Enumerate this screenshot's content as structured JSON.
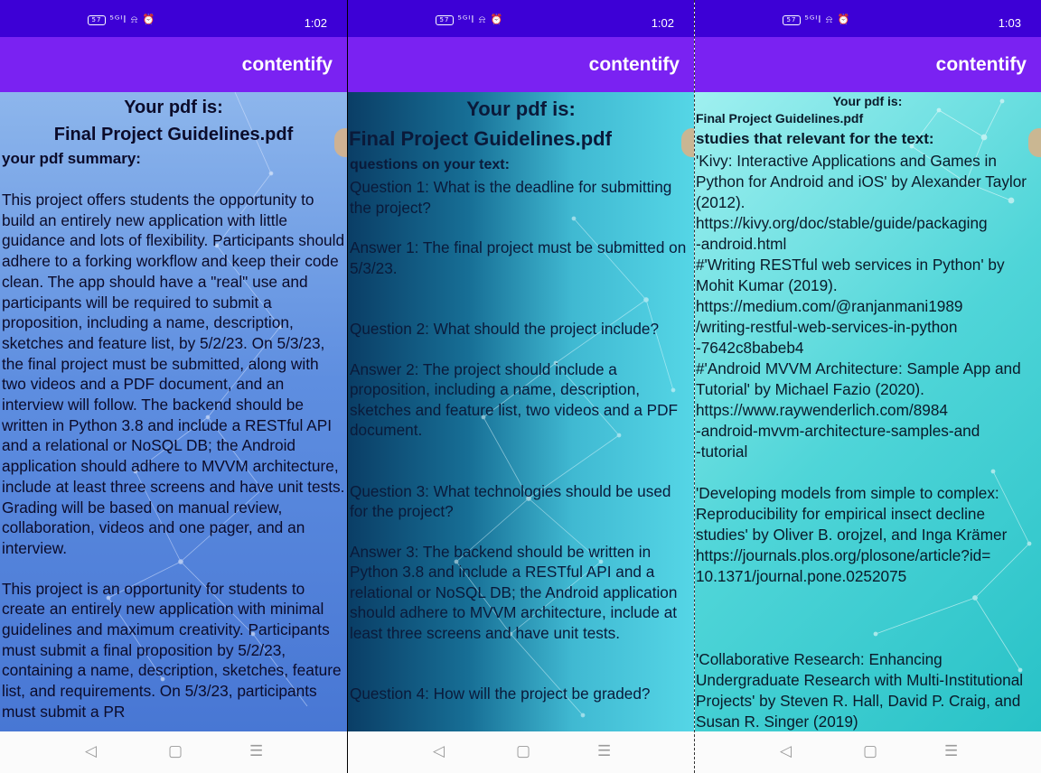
{
  "colors": {
    "status_bar": "#3d00d6",
    "app_bar": "#7a22f2",
    "nav_bar": "#fbfbfb"
  },
  "screens": [
    {
      "status": {
        "icons": "⁵ᴳᴵl ⍾ ⏰",
        "battery": "57",
        "time": "1:02"
      },
      "app_title": "contentify",
      "heading": "Your pdf is:",
      "filename": "Final Project Guidelines.pdf",
      "section": "your pdf summary:",
      "paragraphs": [
        "This project offers students the opportunity to build an entirely new application with little guidance and lots of flexibility. Participants should adhere to a forking workflow and keep their code clean. The app should have a \"real\" use and participants will be required to submit a proposition, including a name, description, sketches and feature list, by 5/2/23. On 5/3/23, the final project must be submitted, along with two videos and a PDF document, and an interview will follow. The backend should be written in Python 3.8 and include a RESTful API and a relational or NoSQL DB; the Android application should adhere to MVVM architecture, include at least three screens and have unit tests. Grading will be based on manual review, collaboration, videos and one pager, and an interview.",
        "This project is an opportunity for students to create an entirely new application with minimal guidelines and maximum creativity. Participants must submit a final proposition by 5/2/23, containing a name, description, sketches, feature list, and requirements. On 5/3/23, participants must submit a PR"
      ],
      "nav": {
        "back": "◁",
        "home": "▢",
        "menu": "☰"
      }
    },
    {
      "status": {
        "icons": "⁵ᴳᴵl ⍾ ⏰",
        "battery": "57",
        "time": "1:02"
      },
      "app_title": "contentify",
      "heading": "Your pdf is:",
      "filename": "Final Project Guidelines.pdf",
      "section": "questions on your text:",
      "qa": [
        "Question 1: What is the deadline for submitting the project?",
        "Answer 1: The final project must be submitted on 5/3/23.",
        "Question 2: What should the project include?",
        "Answer 2: The project should include a proposition, including a name, description, sketches and feature list, two videos and a PDF document.",
        "Question 3: What technologies should be used for the project?",
        "Answer 3: The backend should be written in Python 3.8 and include a RESTful API and a relational or NoSQL DB; the Android application should adhere to MVVM architecture, include at least three screens and have unit tests.",
        "Question 4: How will the project be graded?"
      ],
      "nav": {
        "back": "◁",
        "home": "▢",
        "menu": "☰"
      }
    },
    {
      "status": {
        "icons": "⁵ᴳᴵl ⍾ ⏰",
        "battery": "57",
        "time": "1:03"
      },
      "app_title": "contentify",
      "heading": "Your pdf is:",
      "filename": "Final Project Guidelines.pdf",
      "section": "studies that relevant for the text:",
      "studies": [
        "'Kivy: Interactive Applications and Games in Python for Android and iOS' by Alexander Taylor (2012).\nhttps://kivy.org/doc/stable/guide/packaging\n-android.html\n#'Writing RESTful web services in Python' by Mohit Kumar (2019).\nhttps://medium.com/@ranjanmani1989\n/writing-restful-web-services-in-python\n-7642c8babeb4\n#'Android MVVM Architecture: Sample App and Tutorial' by Michael Fazio (2020).\nhttps://www.raywenderlich.com/8984\n-android-mvvm-architecture-samples-and\n-tutorial",
        "'Developing models from simple to complex: Reproducibility for empirical insect decline studies' by Oliver B. orojzel, and Inga Krämer\nhttps://journals.plos.org/plosone/article?id=\n10.1371/journal.pone.0252075",
        "'Collaborative Research: Enhancing Undergraduate Research with Multi-Institutional Projects' by Steven R. Hall, David P. Craig, and Susan R. Singer (2019)"
      ],
      "nav": {
        "back": "◁",
        "home": "▢",
        "menu": "☰"
      }
    }
  ]
}
